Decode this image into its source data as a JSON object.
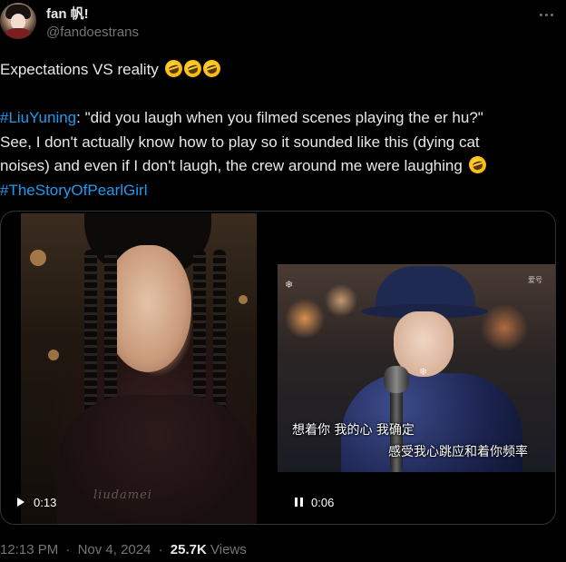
{
  "author": {
    "display_name": "fan 帆!",
    "handle": "@fandoestrans"
  },
  "tweet": {
    "line1_text": "Expectations VS reality ",
    "hashtag_liuyuning": "#LiuYuning",
    "line2_text": ": \"did you laugh when you filmed scenes playing the er hu?\"",
    "line3_text": "See, I don't actually know how to play so it sounded like this (dying cat",
    "line4_text": "noises) and even if I don't laugh, the crew around me were laughing ",
    "hashtag_story": "#TheStoryOfPearlGirl",
    "emojis": [
      "rolling-on-floor-laughing-emoji",
      "rolling-on-floor-laughing-emoji",
      "rolling-on-floor-laughing-emoji",
      "rolling-on-floor-laughing-emoji"
    ]
  },
  "media": {
    "left_video": {
      "duration": "0:13",
      "state": "paused",
      "watermark": "liudamei"
    },
    "right_video": {
      "duration": "0:06",
      "state": "playing",
      "subtitle_1": "想着你  我的心  我确定",
      "subtitle_2": "感受我心跳应和着你频率",
      "corner_tag": "爱号"
    }
  },
  "meta": {
    "time": "12:13 PM",
    "date": "Nov 4, 2024",
    "views_count": "25.7K",
    "views_label": "Views",
    "separator": "·"
  },
  "colors": {
    "background": "#000000",
    "text": "#e7e9ea",
    "secondary": "#71767b",
    "link": "#1d9bf0",
    "border": "#2f3336"
  }
}
